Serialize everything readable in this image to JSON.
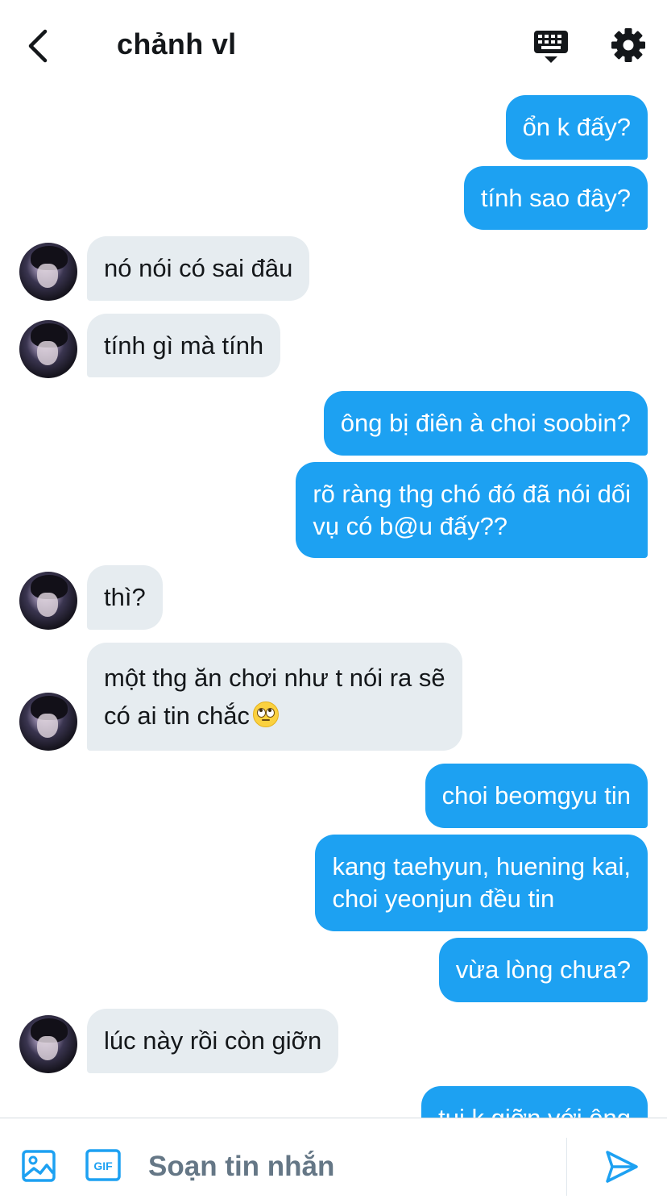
{
  "header": {
    "title": "chảnh vl"
  },
  "messages": [
    {
      "side": "sent",
      "text": "ổn k đấy?"
    },
    {
      "side": "sent",
      "text": "tính sao đây?"
    },
    {
      "side": "recv",
      "text": "nó nói có sai đâu"
    },
    {
      "side": "recv",
      "text": "tính gì mà tính"
    },
    {
      "side": "sent",
      "text": "ông bị điên à choi soobin?"
    },
    {
      "side": "sent",
      "text": "rõ ràng thg chó đó đã nói dối\nvụ có b@u đấy??"
    },
    {
      "side": "recv",
      "text": "thì?"
    },
    {
      "side": "recv",
      "text": "một thg ăn chơi như t nói ra sẽ\ncó ai tin chắc",
      "emoji": "face-with-rolling-eyes"
    },
    {
      "side": "sent",
      "text": "choi beomgyu tin"
    },
    {
      "side": "sent",
      "text": "kang taehyun, huening kai,\nchoi yeonjun đều tin"
    },
    {
      "side": "sent",
      "text": "vừa lòng chưa?"
    },
    {
      "side": "recv",
      "text": "lúc này rồi còn giỡn"
    },
    {
      "side": "sent",
      "text": "tui k giỡn với ông"
    }
  ],
  "composer": {
    "placeholder": "Soạn tin nhắn",
    "gif_label": "GIF"
  },
  "colors": {
    "accent": "#1da1f2",
    "received_bubble": "#e6ecf0",
    "placeholder": "#657786"
  },
  "icons": {
    "back": "chevron-left-icon",
    "keyboard": "keyboard-icon",
    "settings": "gear-icon",
    "image": "image-icon",
    "gif": "gif-icon",
    "send": "send-icon"
  }
}
